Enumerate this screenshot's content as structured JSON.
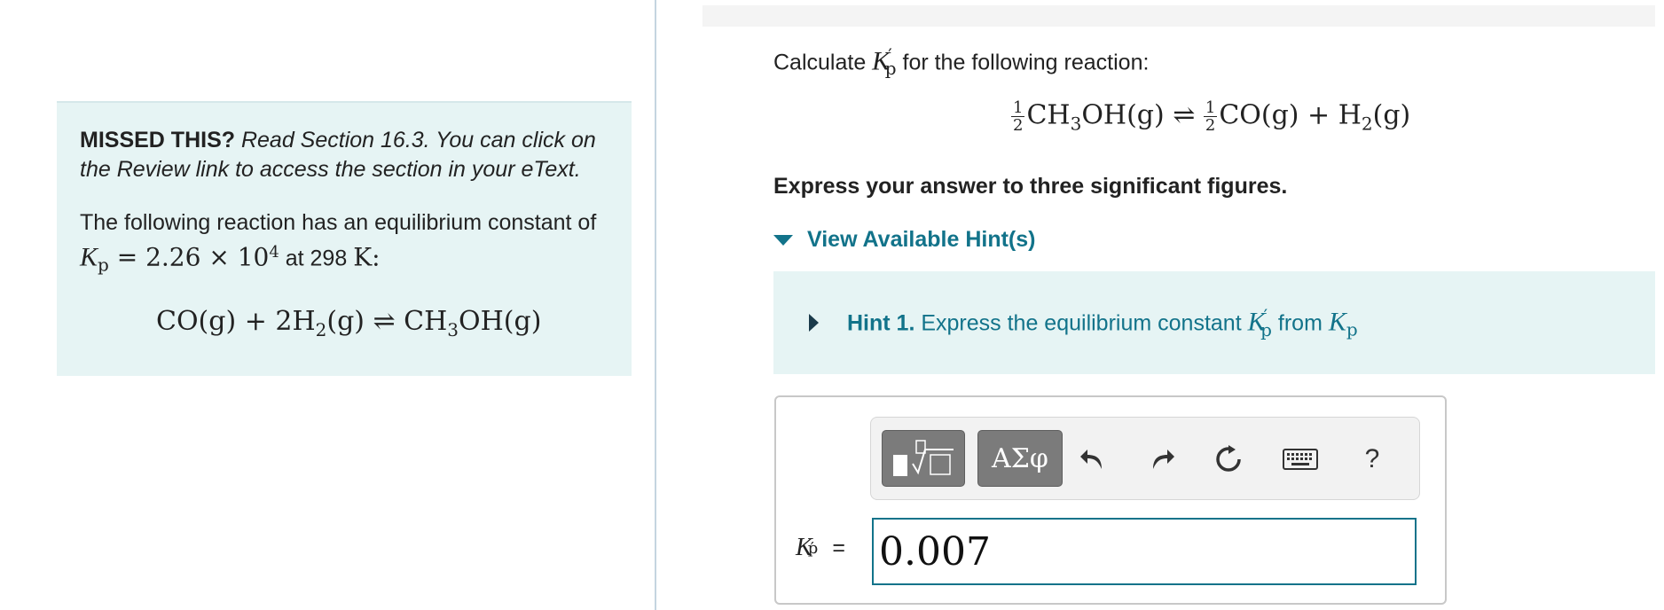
{
  "left_panel": {
    "missed_bold": "MISSED THIS?",
    "missed_italic": " Read Section 16.3. You can click on the Review link to access the section in your eText.",
    "intro_part1": "The following reaction has an equilibrium constant of ",
    "kp_symbol": "K",
    "kp_subscript": "p",
    "kp_value": " = 2.26 × 10",
    "kp_exponent": "4",
    "at_text": " at 298 ",
    "temp_unit": "K",
    "colon": ":",
    "reaction": {
      "r1": "CO(g) + 2H",
      "r1_sub": "2",
      "r2": "(g) ⇌ CH",
      "r2_sub": "3",
      "r3": "OH(g)"
    }
  },
  "question": {
    "prefix": "Calculate ",
    "k_symbol": "K",
    "k_prime": "′",
    "k_sub": "p",
    "suffix": " for the following reaction:",
    "frac_num": "1",
    "frac_den": "2",
    "r1": "CH",
    "r1_sub": "3",
    "r2": "OH(g) ⇌ ",
    "r3": "CO(g) + H",
    "r3_sub": "2",
    "r4": "(g)",
    "instruction": "Express your answer to three significant figures."
  },
  "hints": {
    "toggle_label": "View Available Hint(s)",
    "hint1_label": "Hint 1.",
    "hint1_text": " Express the equilibrium constant ",
    "hint1_from": " from ",
    "k_symbol": "K",
    "k_prime": "′",
    "k_sub": "p"
  },
  "toolbar": {
    "greek_label": "ΑΣφ",
    "help_label": "?",
    "icons": [
      "templates-icon",
      "greek-letters-icon",
      "undo-icon",
      "redo-icon",
      "reset-icon",
      "keyboard-icon",
      "help-icon"
    ]
  },
  "answer": {
    "label_symbol": "K",
    "label_prime": "′",
    "label_sub": "p",
    "equals": "=",
    "value": "0.007"
  },
  "colors": {
    "accent": "#12738a",
    "panel_bg": "#e6f4f4"
  }
}
